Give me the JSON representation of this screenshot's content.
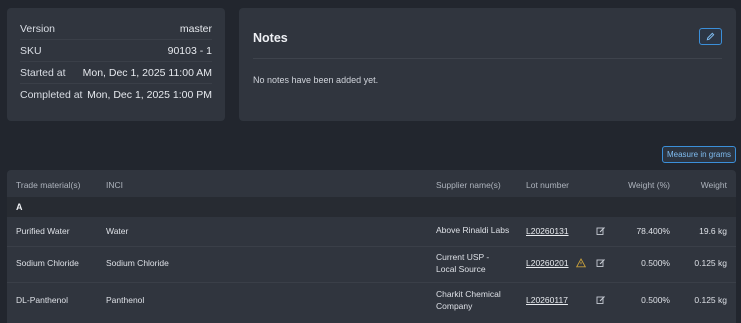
{
  "info": {
    "rows": [
      {
        "label": "Version",
        "value": "master"
      },
      {
        "label": "SKU",
        "value": "90103 - 1"
      },
      {
        "label": "Started at",
        "value": "Mon, Dec 1, 2025 11:00 AM"
      },
      {
        "label": "Completed at",
        "value": "Mon, Dec 1, 2025 1:00 PM"
      }
    ]
  },
  "notes": {
    "title": "Notes",
    "empty_text": "No notes have been added yet.",
    "edit_icon": "pencil-icon"
  },
  "measure_button": "Measure in grams",
  "table": {
    "headers": {
      "trade": "Trade material(s)",
      "inci": "INCI",
      "supplier": "Supplier name(s)",
      "lot": "Lot number",
      "weight_pct": "Weight (%)",
      "weight": "Weight"
    },
    "group": "A",
    "rows": [
      {
        "trade": "Purified Water",
        "inci": "Water",
        "supplier_1": "Above Rinaldi Labs",
        "supplier_2": "",
        "lot": "L20260131",
        "warning": false,
        "weight_pct": "78.400%",
        "weight": "19.6 kg"
      },
      {
        "trade": "Sodium Chloride",
        "inci": "Sodium Chloride",
        "supplier_1": "Current USP -",
        "supplier_2": "Local Source",
        "lot": "L20260201",
        "warning": true,
        "weight_pct": "0.500%",
        "weight": "0.125 kg"
      },
      {
        "trade": "DL-Panthenol",
        "inci": "Panthenol",
        "supplier_1": "Charkit Chemical",
        "supplier_2": "Company",
        "lot": "L20260117",
        "warning": false,
        "weight_pct": "0.500%",
        "weight": "0.125 kg"
      }
    ]
  },
  "colors": {
    "accent": "#3b8fd9",
    "card": "#30353e",
    "background": "#22262e",
    "warning": "#c9a13b"
  }
}
